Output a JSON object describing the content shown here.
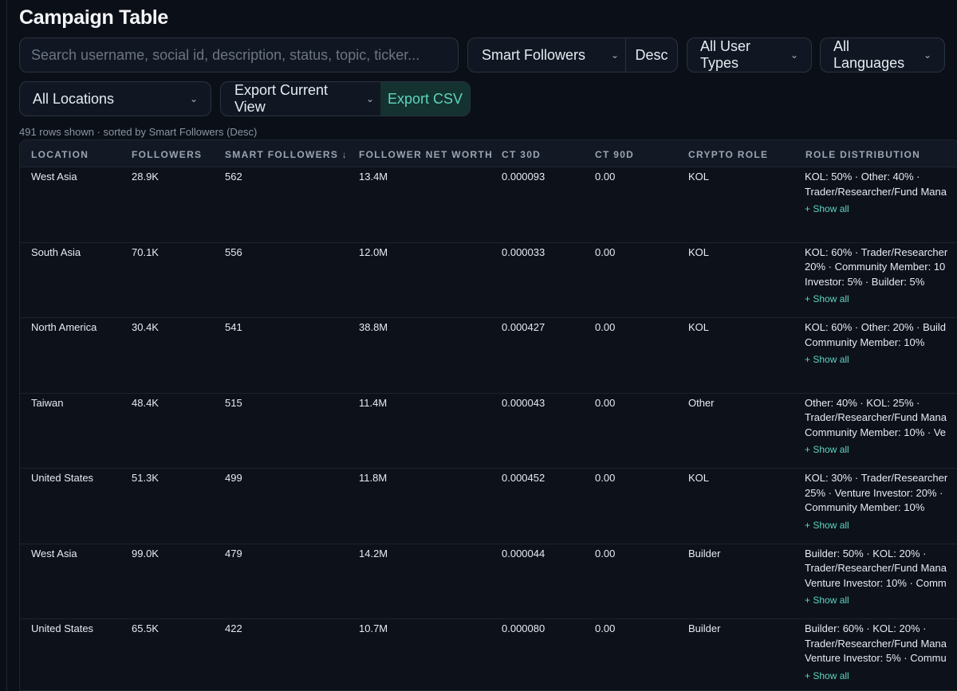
{
  "page": {
    "title": "Campaign Table"
  },
  "filters": {
    "search_placeholder": "Search username, social id, description, status, topic, ticker...",
    "sort_by": "Smart Followers",
    "sort_dir": "Desc",
    "user_types": "All User Types",
    "languages": "All Languages",
    "locations": "All Locations",
    "export_view": "Export Current View",
    "export_csv": "Export CSV"
  },
  "meta": {
    "summary": "491 rows shown · sorted by Smart Followers (Desc)"
  },
  "table": {
    "headers": {
      "location": "LOCATION",
      "followers": "FOLLOWERS",
      "smart_followers": "SMART FOLLOWERS ↓",
      "net_worth": "FOLLOWER NET WORTH",
      "ct30": "CT 30D",
      "ct90": "CT 90D",
      "role": "CRYPTO ROLE",
      "distribution": "ROLE DISTRIBUTION"
    },
    "show_all_label": "+ Show all",
    "rows": [
      {
        "location": "West Asia",
        "followers": "28.9K",
        "smart_followers": "562",
        "net_worth": "13.4M",
        "ct30": "0.000093",
        "ct90": "0.00",
        "role": "KOL",
        "dist": [
          "KOL: 50% · Other: 40% ·",
          "Trader/Researcher/Fund Mana"
        ]
      },
      {
        "location": "South Asia",
        "followers": "70.1K",
        "smart_followers": "556",
        "net_worth": "12.0M",
        "ct30": "0.000033",
        "ct90": "0.00",
        "role": "KOL",
        "dist": [
          "KOL: 60% · Trader/Researcher",
          "20% · Community Member: 10",
          "Investor: 5% · Builder: 5%"
        ]
      },
      {
        "location": "North America",
        "followers": "30.4K",
        "smart_followers": "541",
        "net_worth": "38.8M",
        "ct30": "0.000427",
        "ct90": "0.00",
        "role": "KOL",
        "dist": [
          "KOL: 60% · Other: 20% · Build",
          "Community Member: 10%"
        ]
      },
      {
        "location": "Taiwan",
        "followers": "48.4K",
        "smart_followers": "515",
        "net_worth": "11.4M",
        "ct30": "0.000043",
        "ct90": "0.00",
        "role": "Other",
        "dist": [
          "Other: 40% · KOL: 25% ·",
          "Trader/Researcher/Fund Mana",
          "Community Member: 10% · Ve"
        ]
      },
      {
        "location": "United States",
        "followers": "51.3K",
        "smart_followers": "499",
        "net_worth": "11.8M",
        "ct30": "0.000452",
        "ct90": "0.00",
        "role": "KOL",
        "dist": [
          "KOL: 30% · Trader/Researcher",
          "25% · Venture Investor: 20% ·",
          "Community Member: 10%"
        ]
      },
      {
        "location": "West Asia",
        "followers": "99.0K",
        "smart_followers": "479",
        "net_worth": "14.2M",
        "ct30": "0.000044",
        "ct90": "0.00",
        "role": "Builder",
        "dist": [
          "Builder: 50% · KOL: 20% ·",
          "Trader/Researcher/Fund Mana",
          "Venture Investor: 10% · Comm"
        ]
      },
      {
        "location": "United States",
        "followers": "65.5K",
        "smart_followers": "422",
        "net_worth": "10.7M",
        "ct30": "0.000080",
        "ct90": "0.00",
        "role": "Builder",
        "dist": [
          "Builder: 60% · KOL: 20% ·",
          "Trader/Researcher/Fund Mana",
          "Venture Investor: 5% · Commu"
        ]
      }
    ]
  }
}
